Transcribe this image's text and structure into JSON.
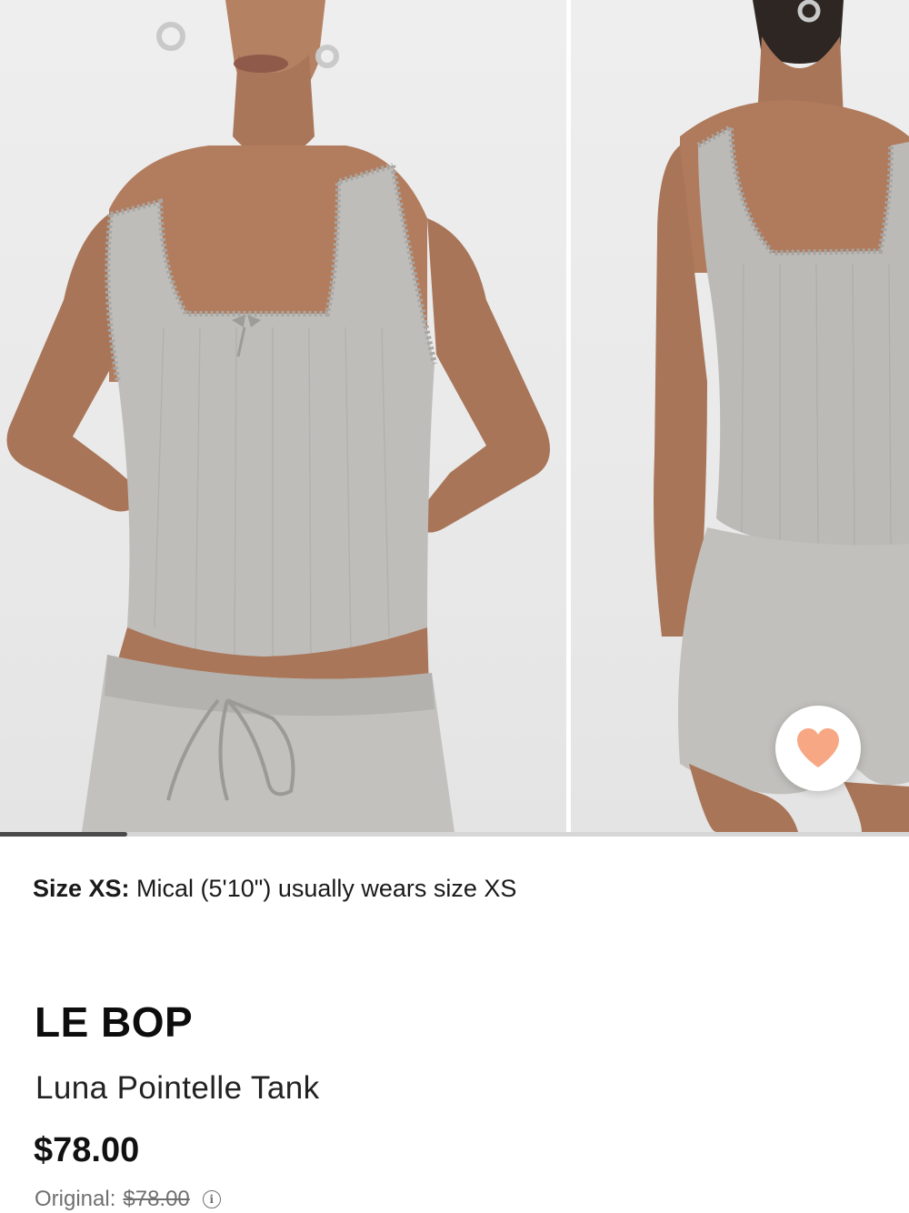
{
  "gallery": {
    "images": [
      {
        "label": "front-view"
      },
      {
        "label": "back-view"
      }
    ],
    "scroll_progress": 0.14,
    "favorite_icon": "heart-icon",
    "favorite_color": "#F7A783"
  },
  "size_note": {
    "label": "Size XS:",
    "text": " Mical (5'10\") usually wears size XS"
  },
  "product": {
    "brand": "LE BOP",
    "name": "Luna Pointelle Tank",
    "price": "$78.00",
    "original_label": "Original:",
    "original_price": "$78.00",
    "info_icon": "info-icon"
  },
  "colors": {
    "garment": "#BDBBB8",
    "skin": "#B07A5C",
    "background": "#ECECEC"
  }
}
